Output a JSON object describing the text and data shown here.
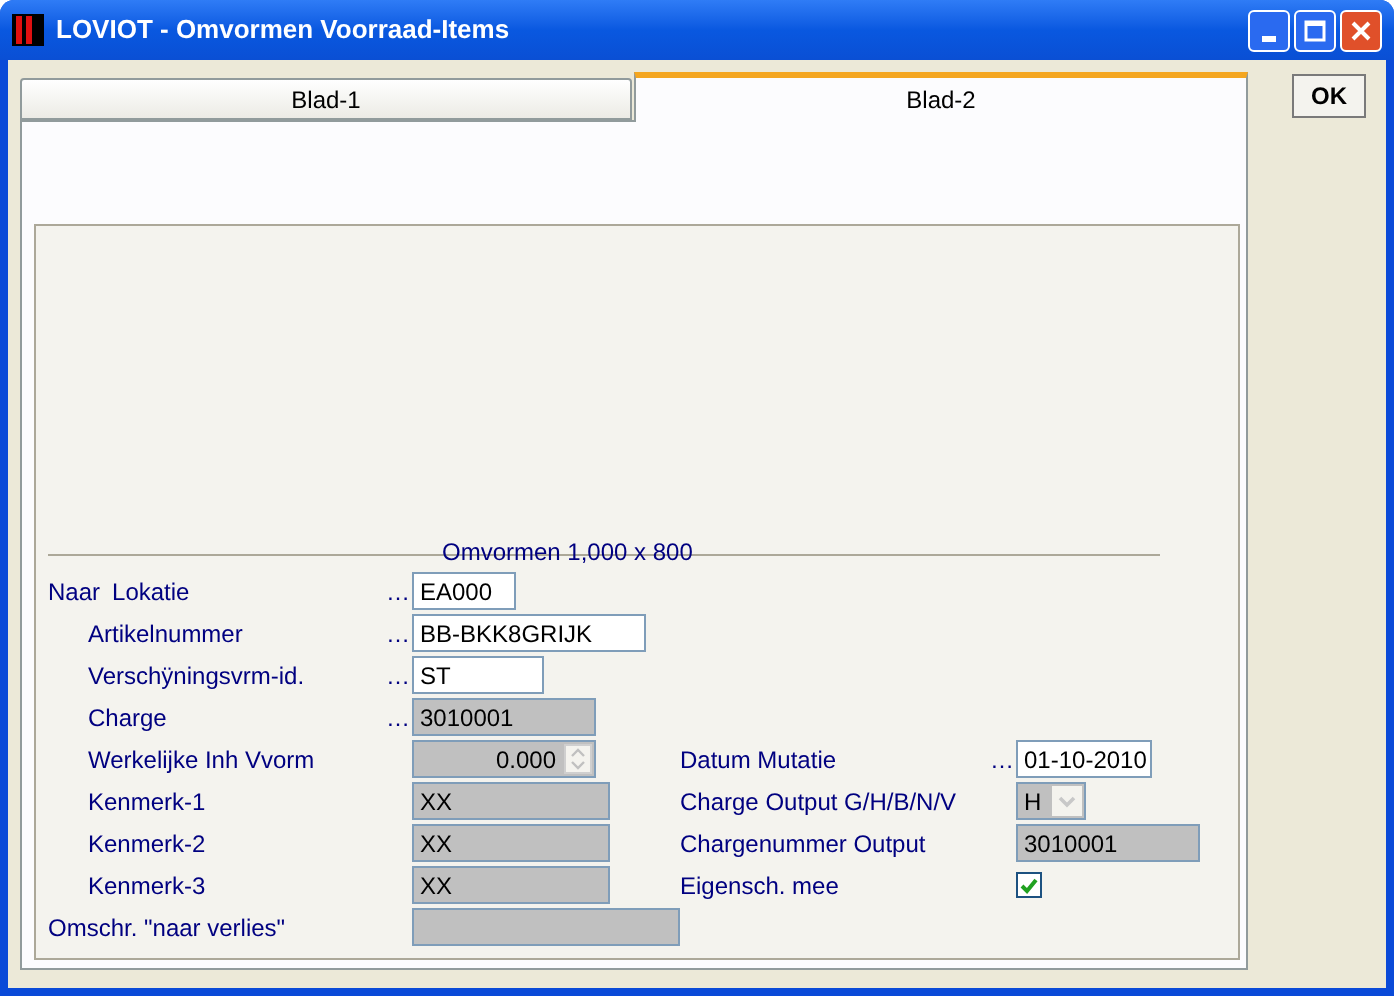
{
  "window": {
    "title": "LOVIOT - Omvormen Voorraad-Items"
  },
  "tabs": [
    {
      "label": "Blad-1",
      "selected": false
    },
    {
      "label": "Blad-2",
      "selected": true
    }
  ],
  "ok_button": {
    "label": "OK"
  },
  "group": {
    "title": "Omvormen 1,000 x 800"
  },
  "rows": [
    {
      "left": {
        "kind": "text",
        "prefix": "Naar",
        "label": "Lokatie",
        "ellipsis": "…",
        "value": "EA000",
        "disabled": false
      },
      "children": [
        {
          "left": {
            "kind": "text",
            "label": "Artikelnummer",
            "ellipsis": "…",
            "value": "BB-BKK8GRIJK",
            "disabled": false
          }
        },
        {
          "left": {
            "kind": "text",
            "label": "Verschÿningsvrm-id.",
            "ellipsis": "…",
            "value": "ST",
            "disabled": false
          }
        },
        {
          "left": {
            "kind": "text",
            "label": "Charge",
            "ellipsis": "…",
            "value": "3010001",
            "disabled": true
          }
        },
        {
          "left": {
            "kind": "spinner",
            "label": "Werkelijke Inh Vvorm",
            "value": "0.000",
            "disabled": true
          },
          "right": {
            "kind": "text",
            "label": "Datum Mutatie",
            "ellipsis": "…",
            "value": "01-10-2010",
            "disabled": false
          }
        },
        {
          "left": {
            "kind": "text",
            "label": "Kenmerk-1",
            "value": "XX",
            "disabled": true
          },
          "right": {
            "kind": "select",
            "label": "Charge Output G/H/B/N/V",
            "value": "H",
            "disabled": true
          }
        },
        {
          "left": {
            "kind": "text",
            "label": "Kenmerk-2",
            "value": "XX",
            "disabled": true
          },
          "right": {
            "kind": "text",
            "label": "Chargenummer Output",
            "value": "3010001",
            "disabled": true
          }
        },
        {
          "left": {
            "kind": "text",
            "label": "Kenmerk-3",
            "value": "XX",
            "disabled": true
          },
          "right": {
            "kind": "checkbox",
            "label": "Eigensch. mee",
            "checked": true
          }
        }
      ]
    },
    {
      "left": {
        "kind": "text",
        "label": "Omschr. \"naar verlies\"",
        "disabled": true
      }
    }
  ]
}
